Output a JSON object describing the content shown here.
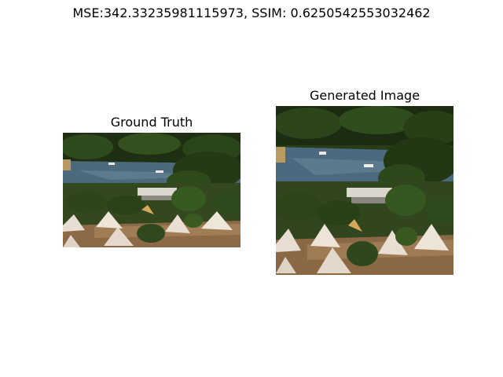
{
  "figure": {
    "suptitle": "MSE:342.33235981115973, SSIM: 0.6250542553032462"
  },
  "panels": [
    {
      "title": "Ground Truth"
    },
    {
      "title": "Generated Image"
    }
  ],
  "colors": {
    "background": "#ffffff",
    "forest_dark": "#1f2f14",
    "forest_mid": "#2f4a1c",
    "water": "#4d6a7d",
    "tent": "#e8ddd2",
    "ground": "#8c6a45"
  }
}
